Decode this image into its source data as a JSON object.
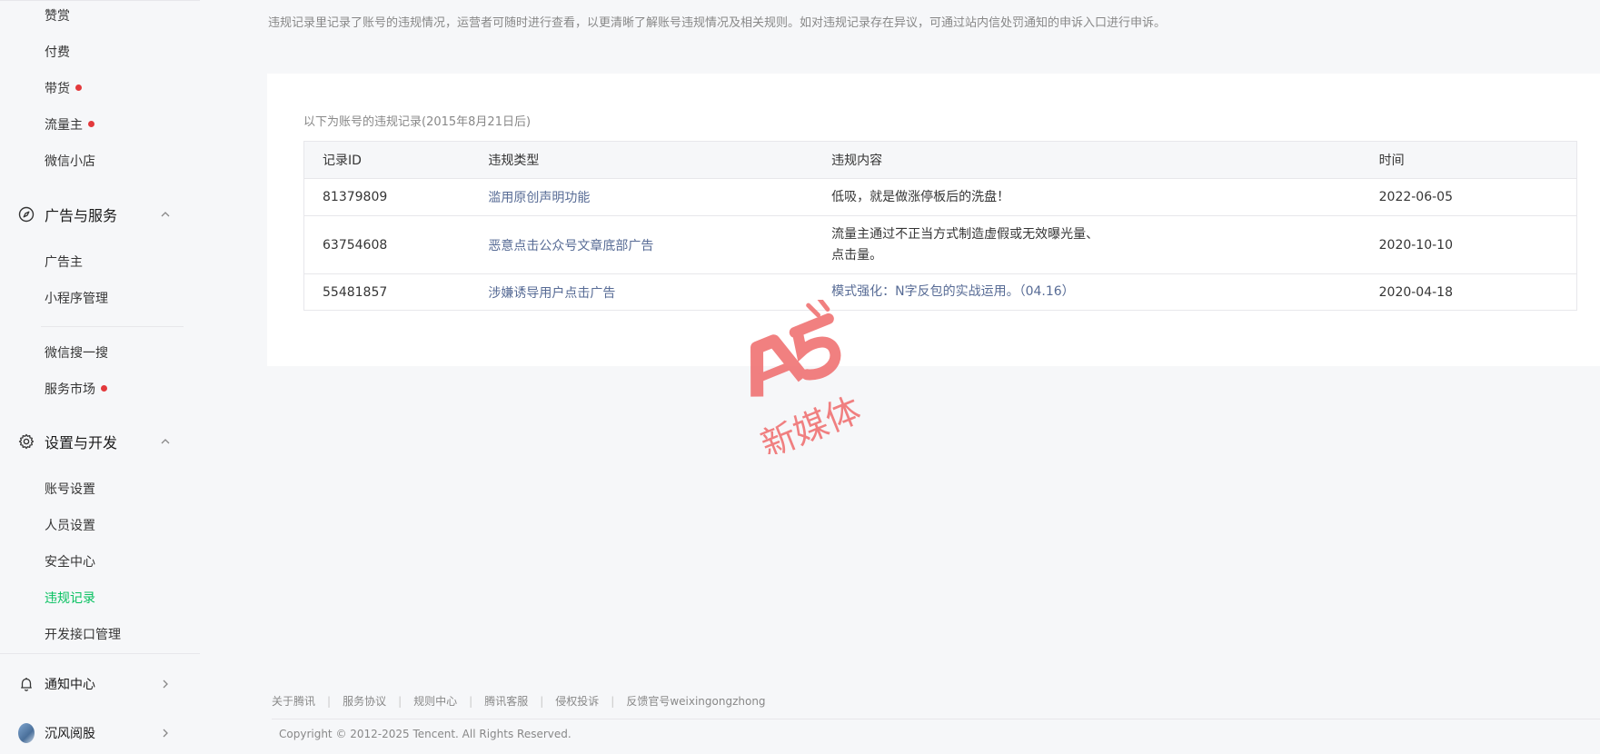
{
  "sidebar": {
    "items_top": [
      {
        "label": "赞赏",
        "dot": false
      },
      {
        "label": "付费",
        "dot": false
      },
      {
        "label": "带货",
        "dot": true
      },
      {
        "label": "流量主",
        "dot": true
      },
      {
        "label": "微信小店",
        "dot": false
      }
    ],
    "group_ads": {
      "label": "广告与服务",
      "items": [
        {
          "label": "广告主",
          "dot": false
        },
        {
          "label": "小程序管理",
          "dot": false
        },
        {
          "label": "微信搜一搜",
          "dot": false
        },
        {
          "label": "服务市场",
          "dot": true
        }
      ]
    },
    "group_settings": {
      "label": "设置与开发",
      "items": [
        {
          "label": "账号设置",
          "dot": false
        },
        {
          "label": "人员设置",
          "dot": false
        },
        {
          "label": "安全中心",
          "dot": false
        },
        {
          "label": "违规记录",
          "dot": false,
          "active": true
        },
        {
          "label": "开发接口管理",
          "dot": false
        }
      ]
    },
    "notifications": {
      "label": "通知中心"
    },
    "account": {
      "label": "沉风阅股"
    }
  },
  "main": {
    "notice": "违规记录里记录了账号的违规情况，运营者可随时进行查看，以更清晰了解账号违规情况及相关规则。如对违规记录存在异议，可通过站内信处罚通知的申诉入口进行申诉。",
    "caption": "以下为账号的违规记录(2015年8月21日后)",
    "table": {
      "headers": [
        "记录ID",
        "违规类型",
        "违规内容",
        "时间"
      ],
      "rows": [
        {
          "id": "81379809",
          "type": "滥用原创声明功能",
          "content_lines": [
            "低吸，就是做涨停板后的洗盘！"
          ],
          "content_link": false,
          "time": "2022-06-05"
        },
        {
          "id": "63754608",
          "type": "恶意点击公众号文章底部广告",
          "content_lines": [
            "流量主通过不正当方式制造虚假或无效曝光量、",
            "点击量。"
          ],
          "content_link": false,
          "time": "2020-10-10"
        },
        {
          "id": "55481857",
          "type": "涉嫌诱导用户点击广告",
          "content_lines": [
            "模式强化：N字反包的实战运用。（04.16）"
          ],
          "content_link": true,
          "time": "2020-04-18"
        }
      ]
    }
  },
  "watermark": {
    "brand": "A5",
    "text": "新媒体"
  },
  "footer": {
    "links": [
      "关于腾讯",
      "服务协议",
      "规则中心",
      "腾讯客服",
      "侵权投诉",
      "反馈官号weixingongzhong"
    ],
    "copyright": "Copyright © 2012-2025 Tencent. All Rights Reserved."
  },
  "colors": {
    "accent": "#07c160",
    "link": "#576b95",
    "dot": "#e3393c",
    "watermark": "#ef6b6b"
  }
}
